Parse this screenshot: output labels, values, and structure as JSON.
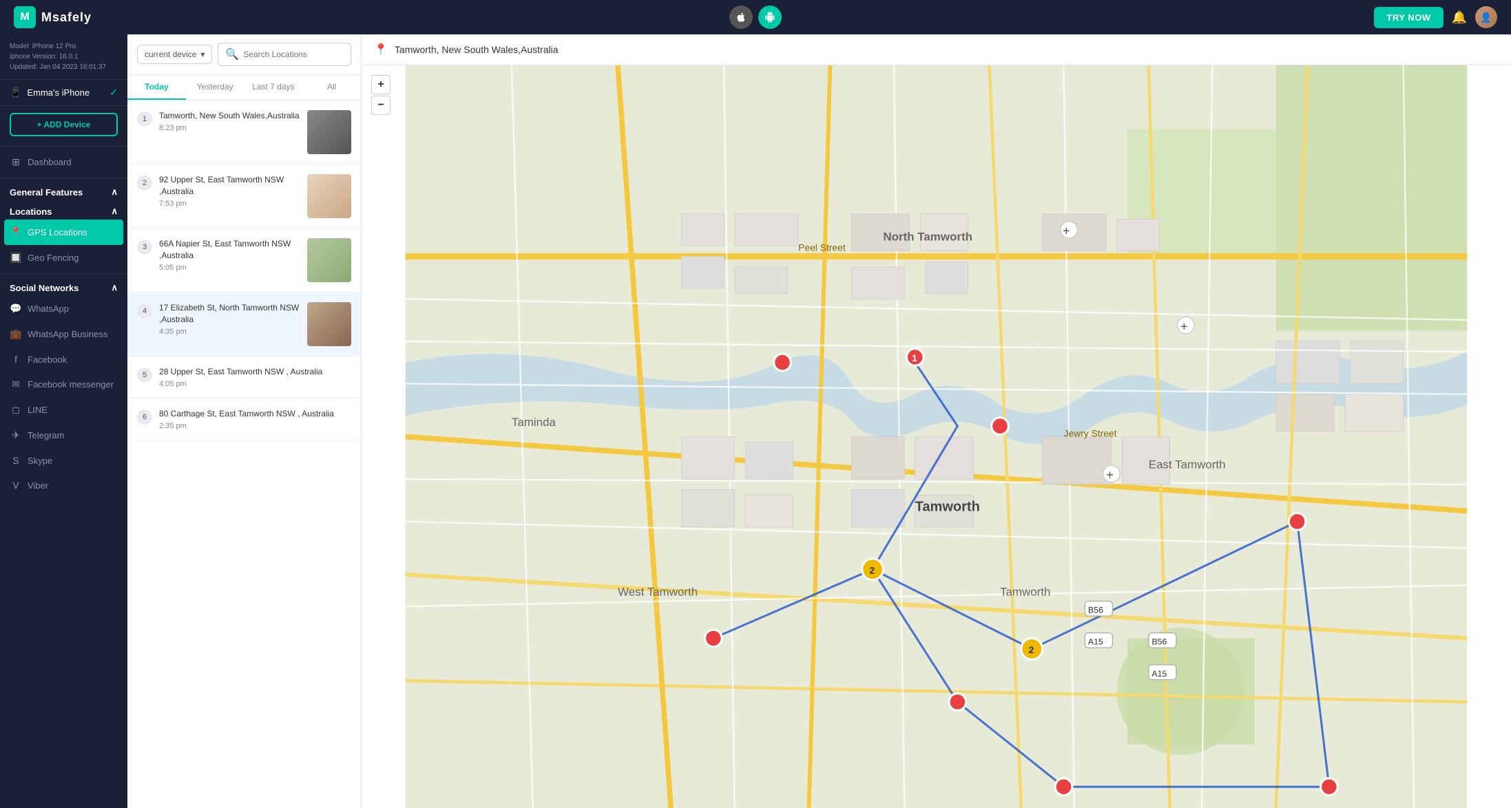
{
  "navbar": {
    "logo_text": "Msafely",
    "try_now_label": "TRY NOW",
    "ios_platform": "iOS",
    "android_platform": "Android"
  },
  "device": {
    "model": "Model: iPhone 12 Pro",
    "version": "iphone Version: 16.0.1",
    "updated": "Updated: Jan 04 2023 16:01:37",
    "name": "Emma's iPhone",
    "add_device_label": "+ ADD Device"
  },
  "sidebar": {
    "dashboard_label": "Dashboard",
    "general_features_label": "General Features",
    "locations_label": "Locations",
    "gps_locations_label": "GPS Locations",
    "geo_fencing_label": "Geo Fencing",
    "social_networks_label": "Social Networks",
    "whatsapp_label": "WhatsApp",
    "whatsapp_business_label": "WhatsApp Business",
    "facebook_label": "Facebook",
    "facebook_messenger_label": "Facebook messenger",
    "line_label": "LINE",
    "telegram_label": "Telegram",
    "skype_label": "Skype",
    "viber_label": "Viber"
  },
  "location_panel": {
    "search_placeholder": "Search Locations",
    "device_selector_label": "current device",
    "tabs": [
      "Today",
      "Yesterday",
      "Last 7 days",
      "All"
    ],
    "active_tab": "Today"
  },
  "locations": [
    {
      "num": "1",
      "address": "Tamworth, New South Wales,Australia",
      "time": "8:23 pm",
      "has_thumb": true,
      "thumb_class": "thumb-1"
    },
    {
      "num": "2",
      "address": "92 Upper St,  East Tamworth NSW ,Australia",
      "time": "7:53 pm",
      "has_thumb": true,
      "thumb_class": "thumb-2"
    },
    {
      "num": "3",
      "address": "66A Napier St,  East Tamworth NSW ,Australia",
      "time": "5:05 pm",
      "has_thumb": true,
      "thumb_class": "thumb-3"
    },
    {
      "num": "4",
      "address": "17 Elizabeth St,  North Tamworth NSW ,Australia",
      "time": "4:35 pm",
      "has_thumb": true,
      "thumb_class": "thumb-4",
      "active": true
    },
    {
      "num": "5",
      "address": "28 Upper St,  East Tamworth NSW , Australia",
      "time": "4:05 pm",
      "has_thumb": false
    },
    {
      "num": "6",
      "address": "80 Carthage St,  East Tamworth NSW , Australia",
      "time": "2:35 pm",
      "has_thumb": false
    }
  ],
  "map": {
    "location_label": "Tamworth, New South Wales,Australia",
    "zoom_in": "+",
    "zoom_out": "−"
  }
}
